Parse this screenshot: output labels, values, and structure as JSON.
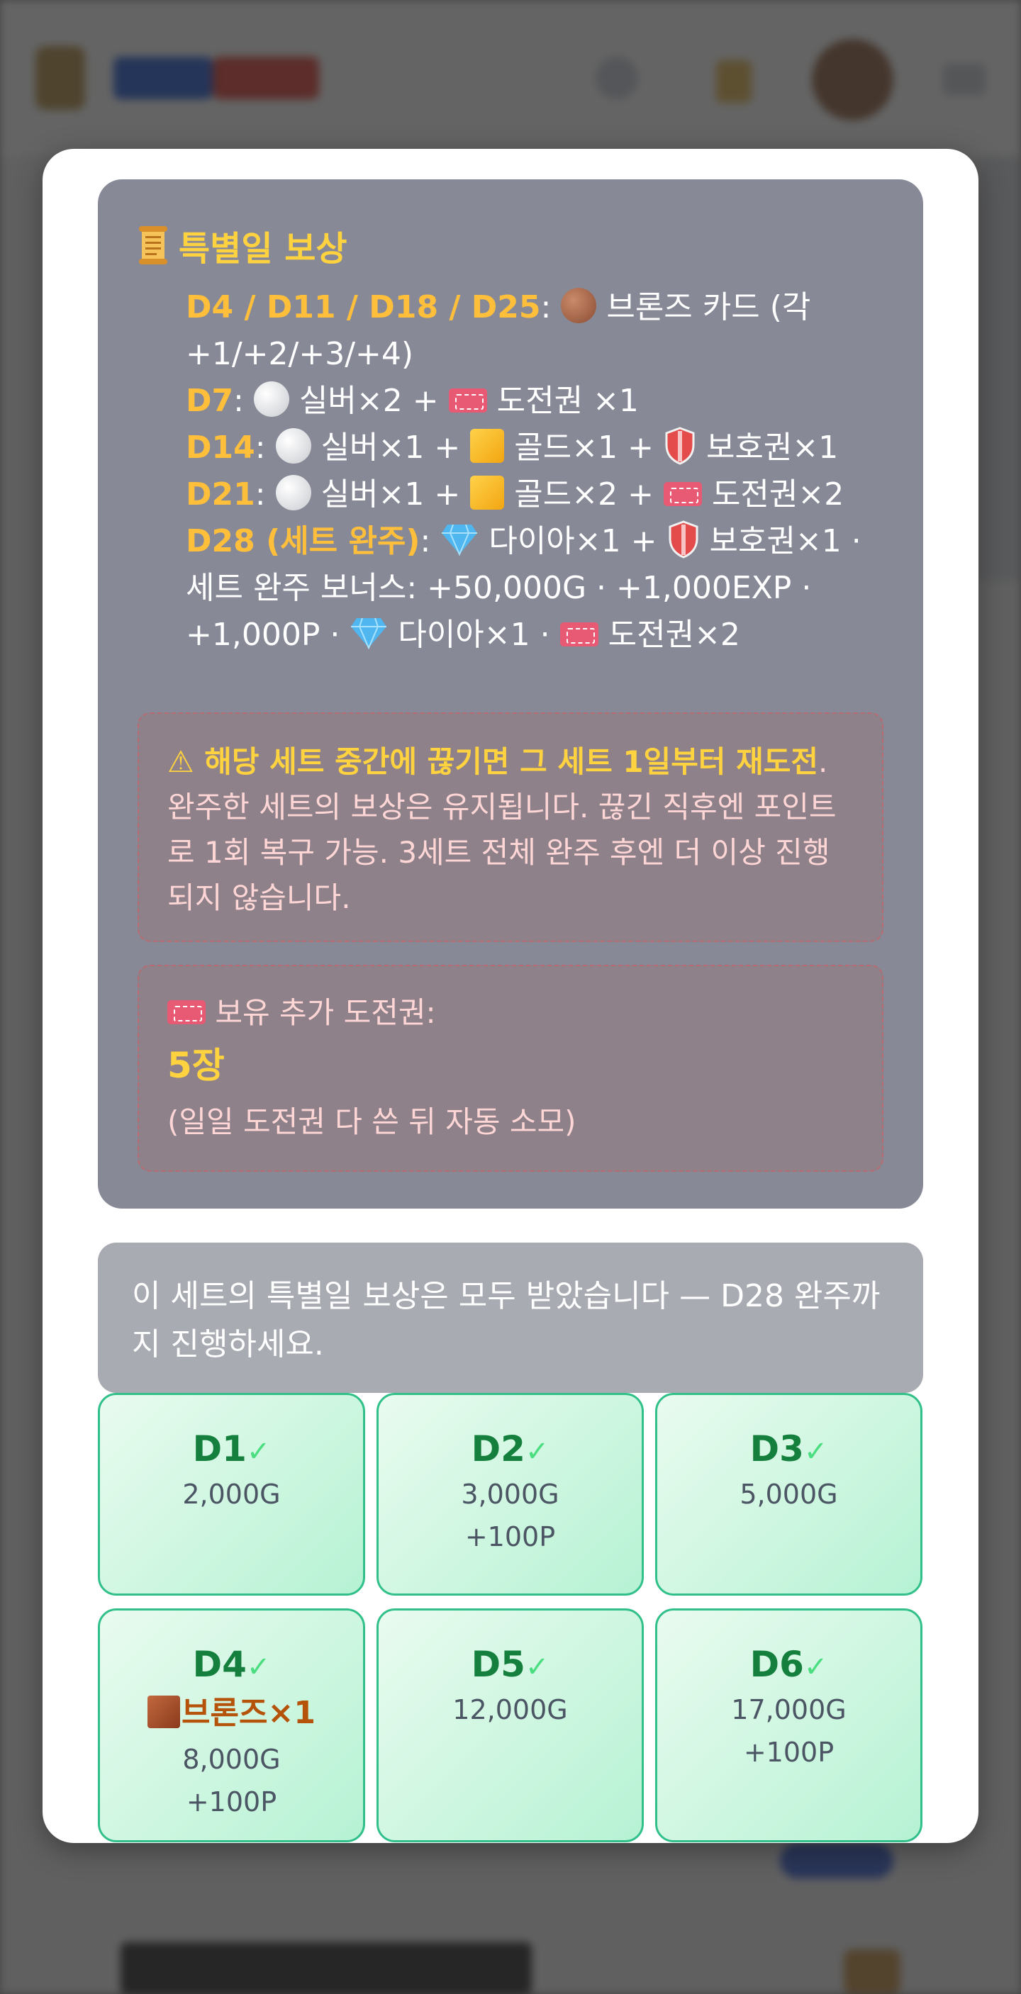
{
  "special": {
    "title": "특별일 보상",
    "lines": [
      {
        "key": "D4 / D11 / D18 / D25",
        "text1": "브론즈 카드 (각",
        "text2": "+1/+2/+3/+4)"
      },
      {
        "key": "D7",
        "silver": "실버×2 +",
        "ticket": "도전권 ×1"
      },
      {
        "key": "D14",
        "silver": "실버×1 +",
        "gold": "골드×1 +",
        "shield": "보호권×1"
      },
      {
        "key": "D21",
        "silver": "실버×1 +",
        "gold": "골드×2 +",
        "ticket": "도전권×2"
      },
      {
        "key": "D28 (세트 완주)",
        "dia": "다이아×1 +",
        "shield": "보호권×1 ·",
        "bonus1": "세트 완주 보너스: +50,000G · +1,000EXP ·",
        "bonus2": "+1,000P ·",
        "bonus2dia": "다이아×1 ·",
        "bonus2ticket": "도전권×2"
      }
    ],
    "warning": {
      "strong": "⚠ 해당 세트 중간에 끊기면 그 세트 1일부터 재도전",
      "rest": ". 완주한 세트의 보상은 유지됩니다. 끊긴 직후엔 포인트로 1회 복구 가능. 3세트 전체 완주 후엔 더 이상 진행되지 않습니다."
    },
    "tickets": {
      "label": "보유 추가 도전권:",
      "count": "5장",
      "note": "(일일 도전권 다 쓴 뒤 자동 소모)"
    }
  },
  "notice": "이 세트의 특별일 보상은 모두 받았습니다 — D28 완주까지 진행하세요.",
  "check_mark": "✓",
  "days": [
    {
      "day": "D1",
      "reward": "2,000G",
      "extra": ""
    },
    {
      "day": "D2",
      "reward": "3,000G",
      "extra": "+100P"
    },
    {
      "day": "D3",
      "reward": "5,000G",
      "extra": ""
    },
    {
      "day": "D4",
      "bonus": "브론즈×1",
      "reward": "8,000G",
      "extra": "+100P"
    },
    {
      "day": "D5",
      "reward": "12,000G",
      "extra": ""
    },
    {
      "day": "D6",
      "reward": "17,000G",
      "extra": "+100P"
    }
  ],
  "colors": {
    "accent": "#ffd23f",
    "key": "#ffbf3a",
    "success": "#15803d",
    "panel": "#878a96"
  }
}
